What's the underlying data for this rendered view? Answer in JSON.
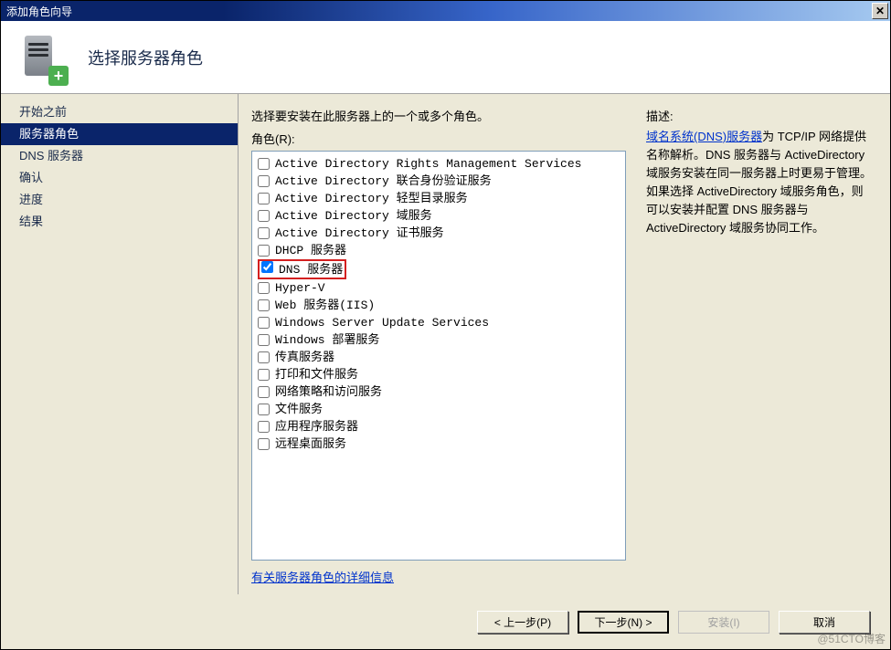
{
  "window": {
    "title": "添加角色向导",
    "close_symbol": "✕"
  },
  "header": {
    "title": "选择服务器角色"
  },
  "sidebar": {
    "items": [
      {
        "label": "开始之前",
        "selected": false
      },
      {
        "label": "服务器角色",
        "selected": true
      },
      {
        "label": "DNS 服务器",
        "selected": false
      },
      {
        "label": "确认",
        "selected": false
      },
      {
        "label": "进度",
        "selected": false
      },
      {
        "label": "结果",
        "selected": false
      }
    ]
  },
  "content": {
    "instruction": "选择要安装在此服务器上的一个或多个角色。",
    "roles_label": "角色(R):",
    "roles": [
      {
        "label": "Active Directory Rights Management Services",
        "checked": false,
        "highlight": false
      },
      {
        "label": "Active Directory 联合身份验证服务",
        "checked": false,
        "highlight": false
      },
      {
        "label": "Active Directory 轻型目录服务",
        "checked": false,
        "highlight": false
      },
      {
        "label": "Active Directory 域服务",
        "checked": false,
        "highlight": false
      },
      {
        "label": "Active Directory 证书服务",
        "checked": false,
        "highlight": false
      },
      {
        "label": "DHCP 服务器",
        "checked": false,
        "highlight": false
      },
      {
        "label": "DNS 服务器",
        "checked": true,
        "highlight": true
      },
      {
        "label": "Hyper-V",
        "checked": false,
        "highlight": false
      },
      {
        "label": "Web 服务器(IIS)",
        "checked": false,
        "highlight": false
      },
      {
        "label": "Windows Server Update Services",
        "checked": false,
        "highlight": false
      },
      {
        "label": "Windows 部署服务",
        "checked": false,
        "highlight": false
      },
      {
        "label": "传真服务器",
        "checked": false,
        "highlight": false
      },
      {
        "label": "打印和文件服务",
        "checked": false,
        "highlight": false
      },
      {
        "label": "网络策略和访问服务",
        "checked": false,
        "highlight": false
      },
      {
        "label": "文件服务",
        "checked": false,
        "highlight": false
      },
      {
        "label": "应用程序服务器",
        "checked": false,
        "highlight": false
      },
      {
        "label": "远程桌面服务",
        "checked": false,
        "highlight": false
      }
    ],
    "more_link": "有关服务器角色的详细信息",
    "description": {
      "heading": "描述:",
      "link_text": "域名系统(DNS)服务器",
      "body": "为 TCP/IP 网络提供名称解析。DNS 服务器与 ActiveDirectory 域服务安装在同一服务器上时更易于管理。如果选择 ActiveDirectory 域服务角色，则可以安装并配置 DNS 服务器与 ActiveDirectory 域服务协同工作。"
    }
  },
  "footer": {
    "prev": "< 上一步(P)",
    "next": "下一步(N) >",
    "install": "安装(I)",
    "cancel": "取消"
  },
  "watermark": "@51CTO博客"
}
